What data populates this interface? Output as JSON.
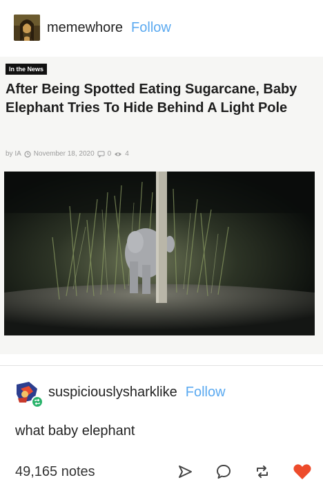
{
  "post": {
    "username": "memewhore",
    "follow_label": "Follow"
  },
  "article": {
    "tag": "In the News",
    "headline": "After Being Spotted Eating Sugarcane, Baby Elephant Tries To Hide Behind A Light Pole",
    "author": "by IA",
    "date": "November 18, 2020",
    "comments": "0",
    "views": "4"
  },
  "reblog": {
    "username": "suspiciouslysharklike",
    "follow_label": "Follow",
    "comment": "what baby elephant"
  },
  "footer": {
    "notes": "49,165 notes"
  },
  "colors": {
    "follow": "#5aa9f0",
    "like": "#ed4b2b",
    "reblog_badge": "#29b36b"
  }
}
